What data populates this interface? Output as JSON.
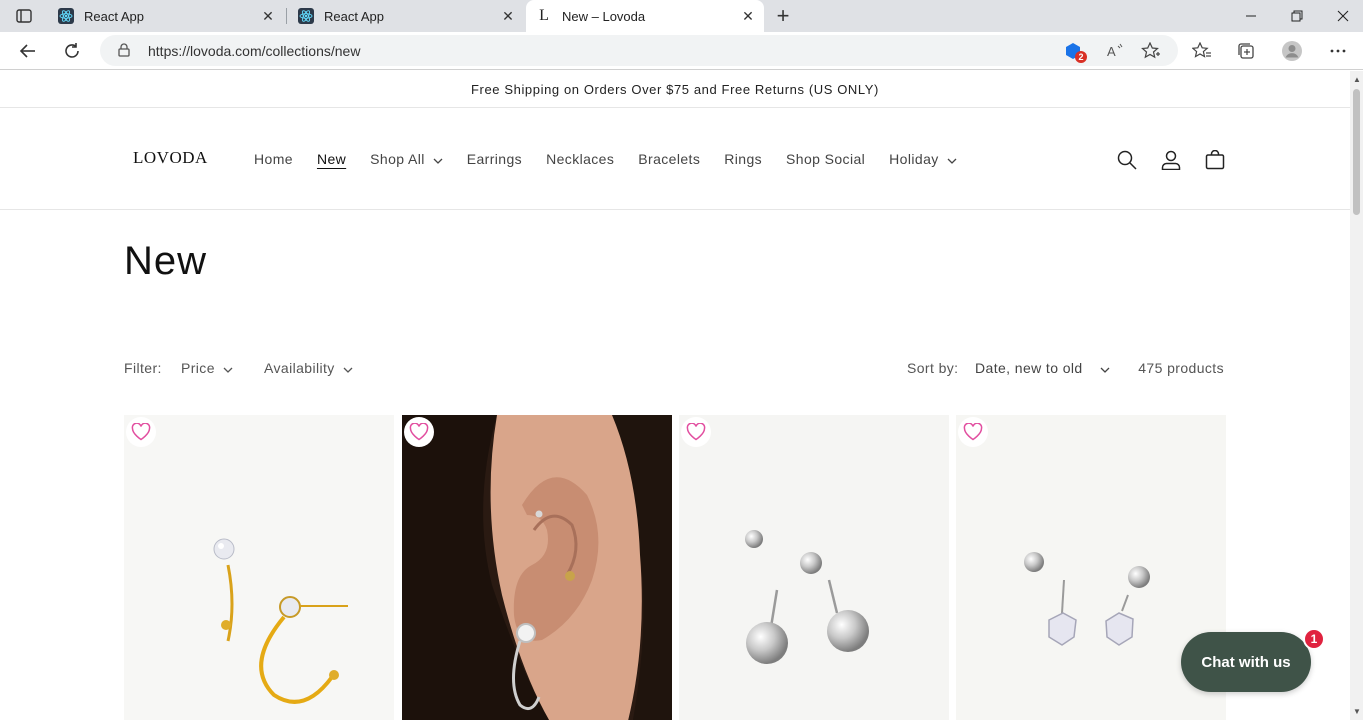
{
  "browser": {
    "tabs": [
      {
        "title": "React App",
        "favicon": "react-icon"
      },
      {
        "title": "React App",
        "favicon": "react-icon"
      },
      {
        "title": "New – Lovoda",
        "favicon": "lovoda-L-icon"
      }
    ],
    "url": "https://lovoda.com/collections/new",
    "extension_badge": "2"
  },
  "site": {
    "announcement": "Free Shipping on Orders Over $75 and Free Returns (US ONLY)",
    "logo": "LOVODA",
    "nav": [
      {
        "label": "Home"
      },
      {
        "label": "New",
        "active": true
      },
      {
        "label": "Shop All",
        "dropdown": true
      },
      {
        "label": "Earrings"
      },
      {
        "label": "Necklaces"
      },
      {
        "label": "Bracelets"
      },
      {
        "label": "Rings"
      },
      {
        "label": "Shop Social"
      },
      {
        "label": "Holiday",
        "dropdown": true
      }
    ]
  },
  "collection": {
    "title": "New",
    "filter_label": "Filter:",
    "filters": [
      "Price",
      "Availability"
    ],
    "sort_label": "Sort by:",
    "sort_value": "Date, new to old",
    "product_count": "475 products"
  },
  "products": [
    {
      "image": "gold hoop earrings with crystal stud"
    },
    {
      "image": "model ear wearing silver crystal hoop"
    },
    {
      "image": "silver ball stud earrings"
    },
    {
      "image": "silver crystal stud earrings"
    }
  ],
  "chat": {
    "label": "Chat with us",
    "badge": "1"
  },
  "colors": {
    "accent_pink": "#e24fa0",
    "chat_bg": "#3f5348",
    "badge_red": "#e0223f"
  }
}
